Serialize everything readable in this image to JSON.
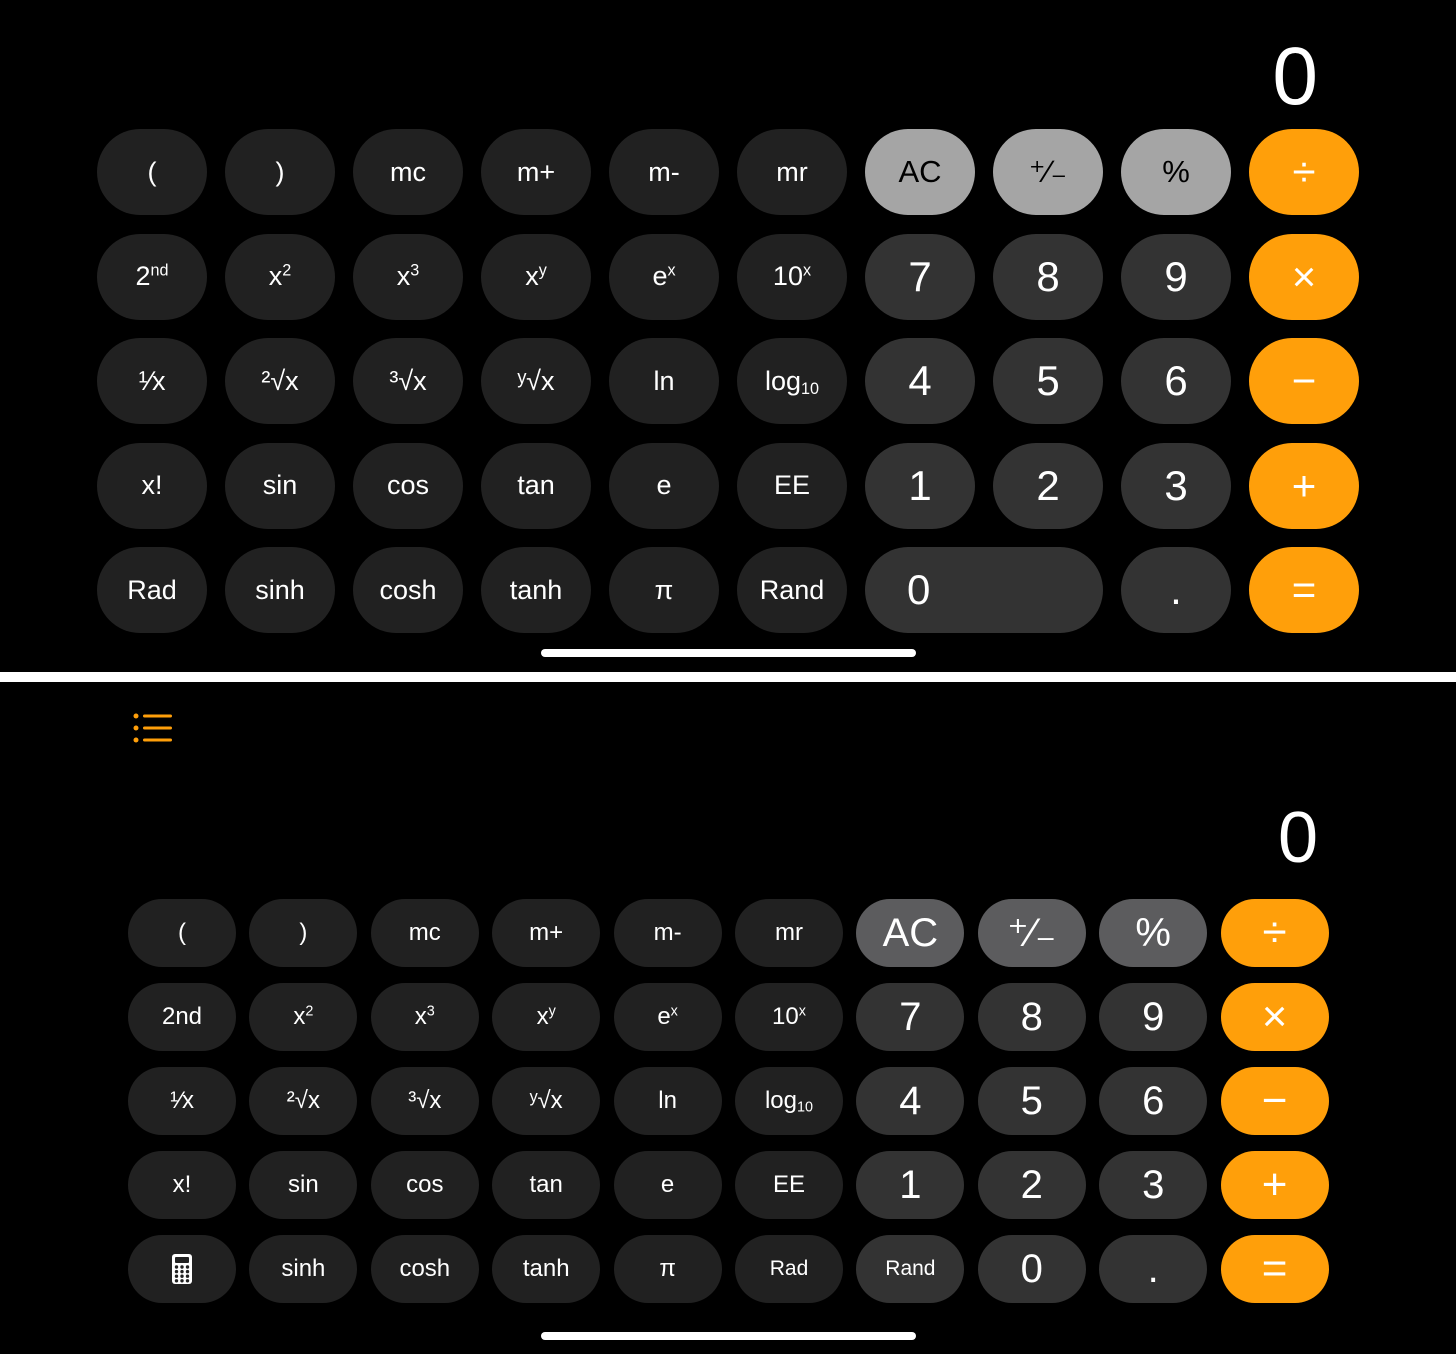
{
  "colors": {
    "background": "#000000",
    "function_key": "#212121",
    "number_key": "#333333",
    "utility_key_top": "#a5a5a5",
    "utility_key_bottom": "#5c5c5e",
    "operator_key": "#ff9f0a",
    "history_icon": "#ff9f0a"
  },
  "top_panel": {
    "display_value": "0",
    "rows": [
      [
        {
          "id": "open-paren",
          "label": "(",
          "kind": "fn"
        },
        {
          "id": "close-paren",
          "label": ")",
          "kind": "fn"
        },
        {
          "id": "mc",
          "label": "mc",
          "kind": "fn"
        },
        {
          "id": "m-plus",
          "label": "m+",
          "kind": "fn"
        },
        {
          "id": "m-minus",
          "label": "m-",
          "kind": "fn"
        },
        {
          "id": "mr",
          "label": "mr",
          "kind": "fn"
        },
        {
          "id": "all-clear",
          "label": "AC",
          "kind": "util"
        },
        {
          "id": "plus-minus",
          "label": "⁺∕₋",
          "kind": "util"
        },
        {
          "id": "percent",
          "label": "%",
          "kind": "util"
        },
        {
          "id": "divide",
          "label": "÷",
          "kind": "op"
        }
      ],
      [
        {
          "id": "second",
          "label": "2",
          "sup": "nd",
          "kind": "fn"
        },
        {
          "id": "x-squared",
          "label": "x",
          "sup": "2",
          "kind": "fn"
        },
        {
          "id": "x-cubed",
          "label": "x",
          "sup": "3",
          "kind": "fn"
        },
        {
          "id": "x-to-y",
          "label": "x",
          "sup": "y",
          "kind": "fn"
        },
        {
          "id": "e-to-x",
          "label": "e",
          "sup": "x",
          "kind": "fn"
        },
        {
          "id": "ten-to-x",
          "label": "10",
          "sup": "x",
          "kind": "fn"
        },
        {
          "id": "digit-7",
          "label": "7",
          "kind": "num"
        },
        {
          "id": "digit-8",
          "label": "8",
          "kind": "num"
        },
        {
          "id": "digit-9",
          "label": "9",
          "kind": "num"
        },
        {
          "id": "multiply",
          "label": "×",
          "kind": "op"
        }
      ],
      [
        {
          "id": "reciprocal",
          "label": "¹∕x",
          "kind": "fn"
        },
        {
          "id": "square-root",
          "label": "²√x",
          "kind": "fn"
        },
        {
          "id": "cube-root",
          "label": "³√x",
          "kind": "fn"
        },
        {
          "id": "y-root",
          "label": "ʸ√x",
          "kind": "fn"
        },
        {
          "id": "ln",
          "label": "ln",
          "kind": "fn"
        },
        {
          "id": "log10",
          "label": "log",
          "sub": "10",
          "kind": "fn"
        },
        {
          "id": "digit-4",
          "label": "4",
          "kind": "num"
        },
        {
          "id": "digit-5",
          "label": "5",
          "kind": "num"
        },
        {
          "id": "digit-6",
          "label": "6",
          "kind": "num"
        },
        {
          "id": "subtract",
          "label": "−",
          "kind": "op"
        }
      ],
      [
        {
          "id": "factorial",
          "label": "x!",
          "kind": "fn"
        },
        {
          "id": "sin",
          "label": "sin",
          "kind": "fn"
        },
        {
          "id": "cos",
          "label": "cos",
          "kind": "fn"
        },
        {
          "id": "tan",
          "label": "tan",
          "kind": "fn"
        },
        {
          "id": "e-const",
          "label": "e",
          "kind": "fn"
        },
        {
          "id": "ee",
          "label": "EE",
          "kind": "fn"
        },
        {
          "id": "digit-1",
          "label": "1",
          "kind": "num"
        },
        {
          "id": "digit-2",
          "label": "2",
          "kind": "num"
        },
        {
          "id": "digit-3",
          "label": "3",
          "kind": "num"
        },
        {
          "id": "add",
          "label": "+",
          "kind": "op"
        }
      ],
      [
        {
          "id": "rad",
          "label": "Rad",
          "kind": "fn"
        },
        {
          "id": "sinh",
          "label": "sinh",
          "kind": "fn"
        },
        {
          "id": "cosh",
          "label": "cosh",
          "kind": "fn"
        },
        {
          "id": "tanh",
          "label": "tanh",
          "kind": "fn"
        },
        {
          "id": "pi",
          "label": "π",
          "kind": "fn"
        },
        {
          "id": "rand",
          "label": "Rand",
          "kind": "fn"
        },
        {
          "id": "digit-0",
          "label": "0",
          "kind": "num",
          "wide": true
        },
        {
          "id": "decimal",
          "label": ".",
          "kind": "num",
          "col": 8
        },
        {
          "id": "equals",
          "label": "=",
          "kind": "op",
          "col": 9
        }
      ]
    ]
  },
  "bottom_panel": {
    "display_value": "0",
    "history_icon": "list-bullet-icon",
    "rows": [
      [
        {
          "id": "open-paren",
          "label": "(",
          "kind": "fn"
        },
        {
          "id": "close-paren",
          "label": ")",
          "kind": "fn"
        },
        {
          "id": "mc",
          "label": "mc",
          "kind": "fn"
        },
        {
          "id": "m-plus",
          "label": "m+",
          "kind": "fn"
        },
        {
          "id": "m-minus",
          "label": "m-",
          "kind": "fn"
        },
        {
          "id": "mr",
          "label": "mr",
          "kind": "fn"
        },
        {
          "id": "all-clear",
          "label": "AC",
          "kind": "util"
        },
        {
          "id": "plus-minus",
          "label": "⁺∕₋",
          "kind": "util"
        },
        {
          "id": "percent",
          "label": "%",
          "kind": "util"
        },
        {
          "id": "divide",
          "label": "÷",
          "kind": "op"
        }
      ],
      [
        {
          "id": "second",
          "label": "2nd",
          "kind": "fn"
        },
        {
          "id": "x-squared",
          "label": "x",
          "sup": "2",
          "kind": "fn"
        },
        {
          "id": "x-cubed",
          "label": "x",
          "sup": "3",
          "kind": "fn"
        },
        {
          "id": "x-to-y",
          "label": "x",
          "sup": "y",
          "kind": "fn"
        },
        {
          "id": "e-to-x",
          "label": "e",
          "sup": "x",
          "kind": "fn"
        },
        {
          "id": "ten-to-x",
          "label": "10",
          "sup": "x",
          "kind": "fn"
        },
        {
          "id": "digit-7",
          "label": "7",
          "kind": "num"
        },
        {
          "id": "digit-8",
          "label": "8",
          "kind": "num"
        },
        {
          "id": "digit-9",
          "label": "9",
          "kind": "num"
        },
        {
          "id": "multiply",
          "label": "×",
          "kind": "op"
        }
      ],
      [
        {
          "id": "reciprocal",
          "label": "¹∕x",
          "kind": "fn"
        },
        {
          "id": "square-root",
          "label": "²√x",
          "kind": "fn"
        },
        {
          "id": "cube-root",
          "label": "³√x",
          "kind": "fn"
        },
        {
          "id": "y-root",
          "label": "ʸ√x",
          "kind": "fn"
        },
        {
          "id": "ln",
          "label": "ln",
          "kind": "fn"
        },
        {
          "id": "log10",
          "label": "log",
          "sub": "10",
          "kind": "fn"
        },
        {
          "id": "digit-4",
          "label": "4",
          "kind": "num"
        },
        {
          "id": "digit-5",
          "label": "5",
          "kind": "num"
        },
        {
          "id": "digit-6",
          "label": "6",
          "kind": "num"
        },
        {
          "id": "subtract",
          "label": "−",
          "kind": "op"
        }
      ],
      [
        {
          "id": "factorial",
          "label": "x!",
          "kind": "fn"
        },
        {
          "id": "sin",
          "label": "sin",
          "kind": "fn"
        },
        {
          "id": "cos",
          "label": "cos",
          "kind": "fn"
        },
        {
          "id": "tan",
          "label": "tan",
          "kind": "fn"
        },
        {
          "id": "e-const",
          "label": "e",
          "kind": "fn"
        },
        {
          "id": "ee",
          "label": "EE",
          "kind": "fn"
        },
        {
          "id": "digit-1",
          "label": "1",
          "kind": "num"
        },
        {
          "id": "digit-2",
          "label": "2",
          "kind": "num"
        },
        {
          "id": "digit-3",
          "label": "3",
          "kind": "num"
        },
        {
          "id": "add",
          "label": "+",
          "kind": "op"
        }
      ],
      [
        {
          "id": "calculator-mode",
          "icon": "calculator-icon",
          "label": "",
          "kind": "fn"
        },
        {
          "id": "sinh",
          "label": "sinh",
          "kind": "fn"
        },
        {
          "id": "cosh",
          "label": "cosh",
          "kind": "fn"
        },
        {
          "id": "tanh",
          "label": "tanh",
          "kind": "fn"
        },
        {
          "id": "pi",
          "label": "π",
          "kind": "fn"
        },
        {
          "id": "rad",
          "label": "Rad",
          "kind": "fn",
          "small": true
        },
        {
          "id": "rand",
          "label": "Rand",
          "kind": "num",
          "small": true
        },
        {
          "id": "digit-0",
          "label": "0",
          "kind": "num"
        },
        {
          "id": "decimal",
          "label": ".",
          "kind": "num"
        },
        {
          "id": "equals",
          "label": "=",
          "kind": "op"
        }
      ]
    ]
  }
}
